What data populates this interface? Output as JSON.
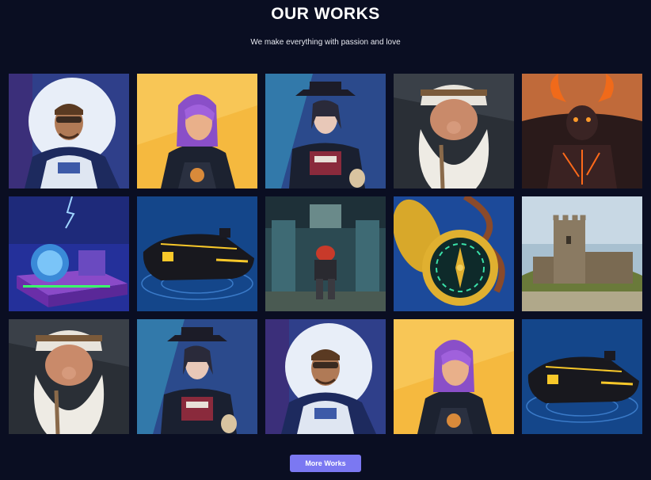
{
  "header": {
    "title": "OUR WORKS",
    "subtitle": "We make everything with passion and love"
  },
  "gallery": {
    "items": [
      {
        "icon": "astronaut-portrait-icon",
        "theme": "astronaut"
      },
      {
        "icon": "purple-hair-woman-portrait-icon",
        "theme": "girl"
      },
      {
        "icon": "gunslinger-woman-portrait-icon",
        "theme": "witch"
      },
      {
        "icon": "dwarf-portrait-icon",
        "theme": "dwarf"
      },
      {
        "icon": "fire-demon-icon",
        "theme": "demon"
      },
      {
        "icon": "neon-machine-icon",
        "theme": "machine"
      },
      {
        "icon": "hover-vehicle-icon",
        "theme": "hover"
      },
      {
        "icon": "robot-warrior-icon",
        "theme": "robot"
      },
      {
        "icon": "golden-compass-icon",
        "theme": "compass"
      },
      {
        "icon": "stone-castle-icon",
        "theme": "castle"
      },
      {
        "icon": "dwarf-portrait-icon",
        "theme": "dwarf"
      },
      {
        "icon": "gunslinger-woman-portrait-icon",
        "theme": "witch"
      },
      {
        "icon": "astronaut-portrait-icon",
        "theme": "astronaut"
      },
      {
        "icon": "purple-hair-woman-portrait-icon",
        "theme": "girl"
      },
      {
        "icon": "hover-vehicle-icon",
        "theme": "hover"
      }
    ]
  },
  "more_button": {
    "label": "More Works",
    "color": "#7b78f2"
  },
  "colors": {
    "background": "#0a0e22",
    "text": "#ffffff"
  }
}
